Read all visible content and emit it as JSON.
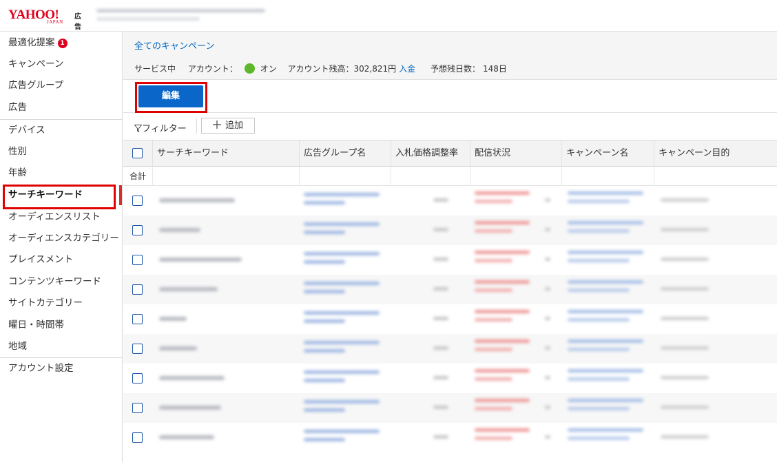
{
  "header": {
    "logo_main": "YAHOO!",
    "logo_sub": "JAPAN",
    "logo_ad": "広告"
  },
  "sidebar": {
    "items": [
      {
        "label": "最適化提案",
        "badge": "1"
      },
      {
        "label": "キャンペーン"
      },
      {
        "label": "広告グループ"
      },
      {
        "label": "広告"
      },
      {
        "label": "デバイス"
      },
      {
        "label": "性別"
      },
      {
        "label": "年齢"
      },
      {
        "label": "サーチキーワード",
        "active": true
      },
      {
        "label": "オーディエンスリスト"
      },
      {
        "label": "オーディエンスカテゴリー"
      },
      {
        "label": "プレイスメント"
      },
      {
        "label": "コンテンツキーワード"
      },
      {
        "label": "サイトカテゴリー"
      },
      {
        "label": "曜日・時間帯"
      },
      {
        "label": "地域"
      },
      {
        "label": "アカウント設定"
      }
    ]
  },
  "main": {
    "breadcrumb": "全てのキャンペーン",
    "status": {
      "service": "サービス中",
      "account_label": "アカウント：",
      "account_state": "オン",
      "balance_label": "アカウント残高：302,821円",
      "deposit_link": "入金",
      "days_label": "予想残日数：",
      "days_value": "148日"
    },
    "edit_button": "編集",
    "filter_label": "フィルター",
    "add_button": "追加"
  },
  "table": {
    "columns": [
      "サーチキーワード",
      "広告グループ名",
      "入札価格調整率",
      "配信状況",
      "キャンペーン名",
      "キャンペーン目的"
    ],
    "total_label": "合計",
    "row_count": 9
  },
  "colors": {
    "accent": "#0a66c8",
    "brand": "#e0001e",
    "highlight": "#e00000",
    "status_on": "#5cb82a"
  },
  "icons": {
    "filter": "funnel-icon",
    "add": "plus-icon",
    "status": "green-dot-icon"
  }
}
